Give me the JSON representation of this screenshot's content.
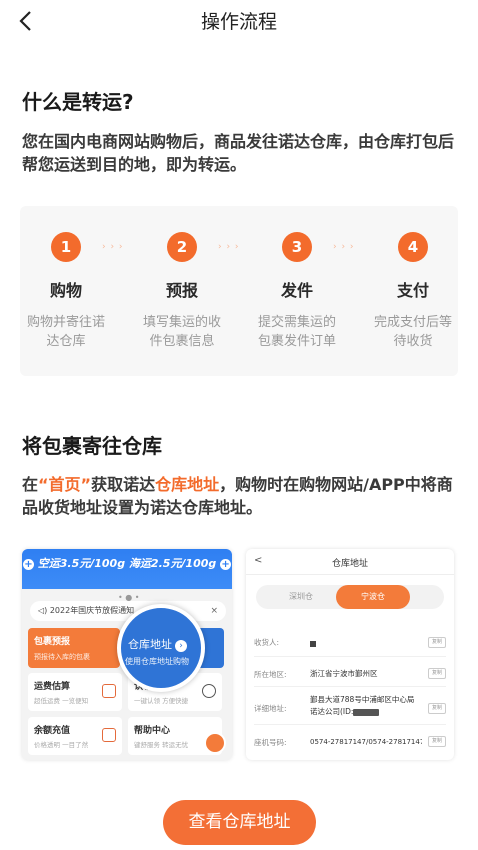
{
  "header": {
    "title": "操作流程",
    "back_icon": "chevron-left-icon"
  },
  "section1": {
    "title": "什么是转运?",
    "body": "您在国内电商网站购物后，商品发往诺达仓库，由仓库打包后帮您运送到目的地，即为转运。"
  },
  "steps": [
    {
      "number": "1",
      "name": "购物",
      "desc": "购物并寄往诺达仓库"
    },
    {
      "number": "2",
      "name": "预报",
      "desc": "填写集运的收件包裹信息"
    },
    {
      "number": "3",
      "name": "发件",
      "desc": "提交需集运的包裹发件订单"
    },
    {
      "number": "4",
      "name": "支付",
      "desc": "完成支付后等待收货"
    }
  ],
  "step_arrow": "› › ›",
  "section2": {
    "title": "将包裹寄往仓库",
    "body_prefix": "在",
    "hl_home": "“首页”",
    "body_mid": "获取诺达",
    "hl_address": "仓库地址",
    "body_suffix": "，购物时在购物网站/APP中将商品收货地址设置为诺达仓库地址。"
  },
  "shot_left": {
    "banner_air": "空运3.5元/100g",
    "banner_sea": "海运2.5元/100g",
    "carousel_dots": "• ● •",
    "notice": "2022年国庆节放假通知",
    "notice_close": "×",
    "card_forecast": "包裹预报",
    "card_forecast_sub": "预报待入库的包裹",
    "magnifier_title": "仓库地址",
    "magnifier_sub": "使用仓库地址购物",
    "card_fee": "运费估算",
    "card_fee_sub": "超低运费 一览便知",
    "card_claim": "认领包裹",
    "card_claim_sub": "一键认领 方便快捷",
    "card_recharge": "余额充值",
    "card_recharge_sub": "价格透明 一目了然",
    "card_help": "帮助中心",
    "card_help_sub": "键舒服务 转运无忧"
  },
  "shot_right": {
    "title": "仓库地址",
    "back": "<",
    "tab_shenzhen": "深圳仓",
    "tab_ningbo": "宁波仓",
    "label_receiver": "收货人:",
    "label_region": "所在地区:",
    "value_region": "浙江省宁波市鄞州区",
    "label_address": "详细地址:",
    "value_address_1": "鄞县大道788号中浦邮区中心局",
    "value_address_2": "诺达公司(ID:",
    "label_phone": "座机号码:",
    "value_phone": "0574-27817147/0574-27817147",
    "copy": "复制"
  },
  "cta": {
    "label": "查看仓库地址"
  },
  "colors": {
    "accent": "#f36b2c",
    "blue": "#2f7ff2"
  }
}
